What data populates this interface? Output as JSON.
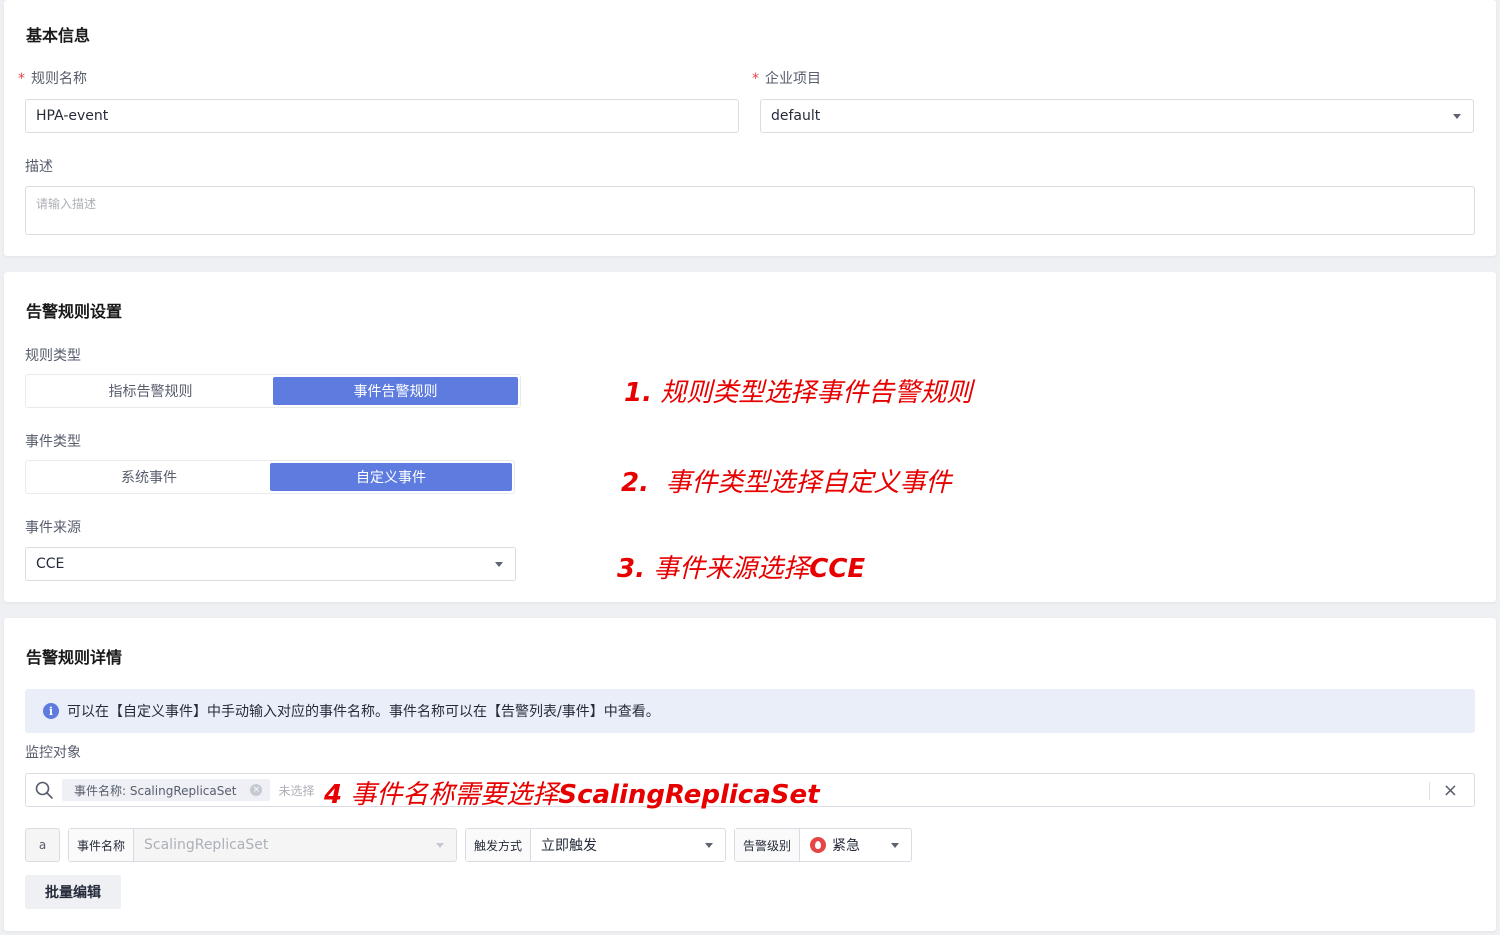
{
  "basic": {
    "title": "基本信息",
    "rule_name_label": "规则名称",
    "rule_name_value": "HPA-event",
    "project_label": "企业项目",
    "project_value": "default",
    "desc_label": "描述",
    "desc_placeholder": "请输入描述",
    "required_mark": "*"
  },
  "settings": {
    "title": "告警规则设置",
    "rule_type_label": "规则类型",
    "rule_type_options": [
      "指标告警规则",
      "事件告警规则"
    ],
    "rule_type_selected": "事件告警规则",
    "event_type_label": "事件类型",
    "event_type_options": [
      "系统事件",
      "自定义事件"
    ],
    "event_type_selected": "自定义事件",
    "event_source_label": "事件来源",
    "event_source_value": "CCE"
  },
  "annotations": {
    "a1_num": "1.",
    "a1_text": "规则类型选择事件告警规则",
    "a2_num": "2.",
    "a2_text": "事件类型选择自定义事件",
    "a3_num": "3.",
    "a3_text": "事件来源选择",
    "a3_bold": "CCE",
    "a4_num": "4",
    "a4_text": "事件名称需要选择",
    "a4_bold": "ScalingReplicaSet"
  },
  "details": {
    "title": "告警规则详情",
    "info_icon": "i",
    "info_text": "可以在【自定义事件】中手动输入对应的事件名称。事件名称可以在【告警列表/事件】中查看。",
    "monitor_label": "监控对象",
    "tag_text": "事件名称: ScalingReplicaSet",
    "tag_close": "×",
    "search_placeholder": "未选择",
    "clear": "×",
    "row_prefix": "a",
    "event_name_label": "事件名称",
    "event_name_value": "ScalingReplicaSet",
    "trigger_label": "触发方式",
    "trigger_value": "立即触发",
    "level_label": "告警级别",
    "level_value": "紧急",
    "batch_edit": "批量编辑"
  },
  "colors": {
    "accent": "#5e7ce0",
    "annotation": "#e60000",
    "urgent": "#e54545"
  }
}
